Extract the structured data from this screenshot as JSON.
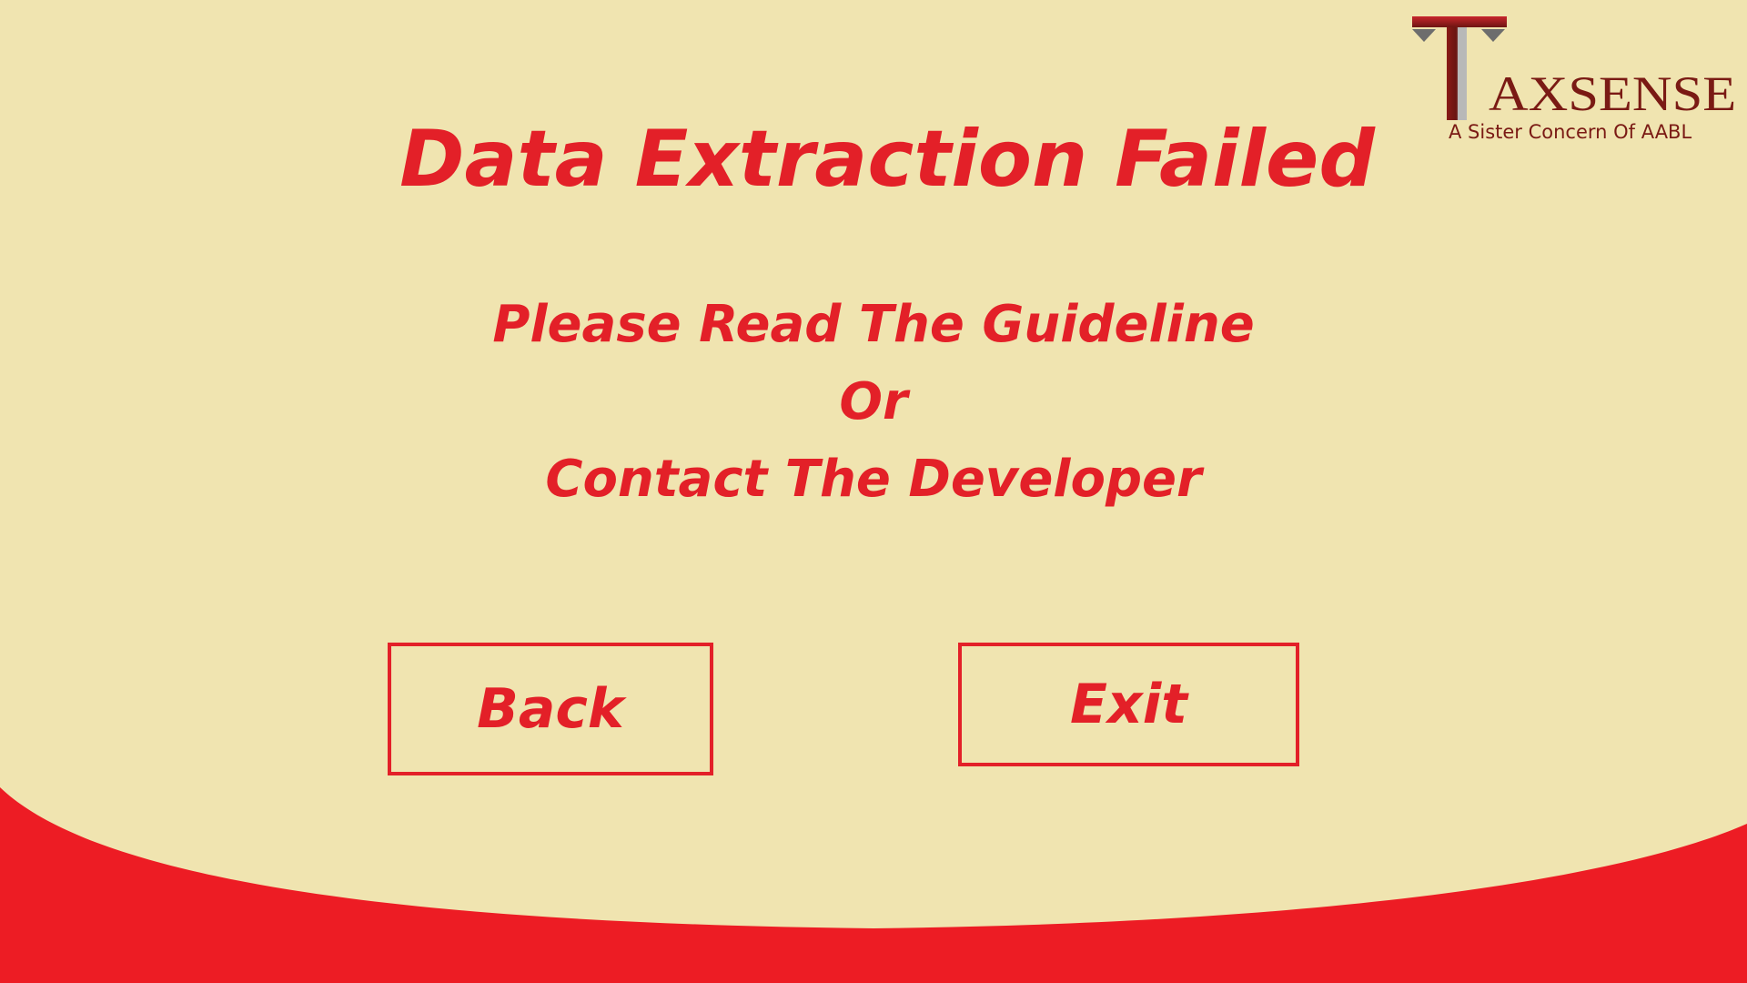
{
  "screen": {
    "title": "Data Extraction Failed",
    "message_lines": [
      "Please Read The Guideline",
      "Or",
      "Contact The Developer"
    ]
  },
  "buttons": {
    "back_label": "Back",
    "exit_label": "Exit"
  },
  "logo": {
    "wordmark": "AXSENSE",
    "tagline": "A Sister Concern Of AABL"
  },
  "colors": {
    "background": "#f0e4b0",
    "accent_red": "#e32028",
    "logo_maroon": "#7a1a14"
  }
}
